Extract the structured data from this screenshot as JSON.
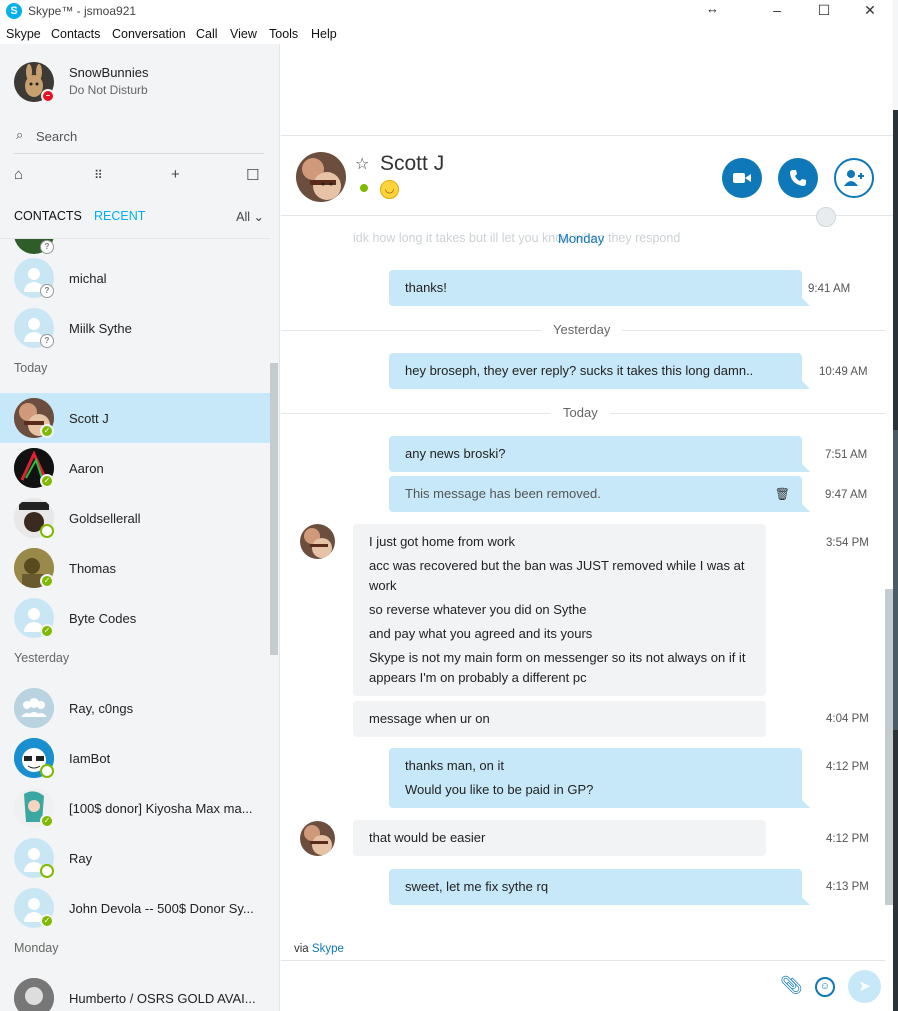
{
  "window": {
    "title": "Skype™ - jsmoa921",
    "logo_letter": "S",
    "resize_glyph": "↔",
    "minimize_glyph": "–",
    "maximize_glyph": "☐",
    "close_glyph": "✕"
  },
  "menu": [
    "Skype",
    "Contacts",
    "Conversation",
    "Call",
    "View",
    "Tools",
    "Help"
  ],
  "profile": {
    "name": "SnowBunnies",
    "status": "Do Not Disturb"
  },
  "search": {
    "placeholder": "Search"
  },
  "tabs": {
    "contacts": "CONTACTS",
    "recent": "RECENT",
    "filter": "All"
  },
  "sections": {
    "today": "Today",
    "yesterday": "Yesterday",
    "monday": "Monday"
  },
  "contacts": [
    {
      "name": "michal",
      "status": "unknown"
    },
    {
      "name": "Miilk Sythe",
      "status": "unknown"
    },
    {
      "name": "Scott J",
      "status": "online",
      "selected": true
    },
    {
      "name": "Aaron",
      "status": "online"
    },
    {
      "name": "Goldsellerall",
      "status": "away-empty"
    },
    {
      "name": "Thomas",
      "status": "online"
    },
    {
      "name": "Byte Codes",
      "status": "online"
    },
    {
      "name": "Ray, c0ngs",
      "status": "group"
    },
    {
      "name": "IamBot",
      "status": "away-empty"
    },
    {
      "name": "[100$ donor] Kiyosha Max ma...",
      "status": "online"
    },
    {
      "name": "Ray",
      "status": "away-empty"
    },
    {
      "name": "John Devola -- 500$ Donor Sy...",
      "status": "online"
    },
    {
      "name": "Humberto / OSRS GOLD AVAI...",
      "status": "online"
    }
  ],
  "chat": {
    "contact_name": "Scott J",
    "mood_emoji": "😁",
    "faded_text": "idk how long it takes but ill let you know when they respond",
    "days": {
      "monday": "Monday",
      "yesterday": "Yesterday",
      "today": "Today"
    },
    "messages": [
      {
        "dir": "out",
        "lines": [
          "thanks!"
        ],
        "time": "9:41 AM"
      },
      {
        "dir": "out",
        "lines": [
          "hey broseph, they ever reply? sucks it takes this long damn.."
        ],
        "time": "10:49 AM"
      },
      {
        "dir": "out",
        "lines": [
          "any news broski?"
        ],
        "time": "7:51 AM"
      },
      {
        "dir": "out",
        "lines": [
          "This message has been removed."
        ],
        "time": "9:47 AM",
        "removed": true
      },
      {
        "dir": "in",
        "lines": [
          "I just got home from work",
          "acc was recovered but the ban was JUST removed while I was at work",
          "so reverse whatever you did on Sythe",
          "and pay what you agreed and its yours",
          "Skype is not my main form on messenger so its not always on if it appears I'm on probably a different pc"
        ],
        "time": "3:54 PM"
      },
      {
        "dir": "in",
        "lines": [
          "message when ur on"
        ],
        "time": "4:04 PM"
      },
      {
        "dir": "out",
        "lines": [
          "thanks man, on it",
          "Would you like to be paid in GP?"
        ],
        "time": "4:12 PM"
      },
      {
        "dir": "in",
        "lines": [
          "that would be easier"
        ],
        "time": "4:12 PM"
      },
      {
        "dir": "out",
        "lines": [
          "sweet, let me fix sythe rq"
        ],
        "time": "4:13 PM"
      }
    ],
    "via_prefix": "via",
    "via_link": "Skype"
  },
  "colors": {
    "accent": "#00aff0",
    "button": "#0f78b8",
    "bubble_out": "#c7e8f8",
    "bubble_in": "#f1f3f4",
    "online": "#7fba00"
  }
}
